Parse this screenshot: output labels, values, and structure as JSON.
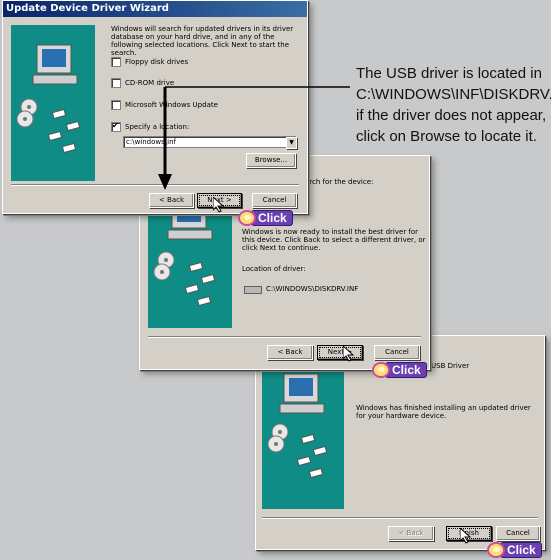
{
  "window1": {
    "title": "Update Device Driver Wizard",
    "intro": "Windows will search for updated drivers in its driver database on your hard drive, and in any of the following selected locations. Click Next to start the search.",
    "options": [
      {
        "label": "Floppy disk drives",
        "checked": false
      },
      {
        "label": "CD-ROM drive",
        "checked": false
      },
      {
        "label": "Microsoft Windows Update",
        "checked": false
      },
      {
        "label": "Specify a location:",
        "checked": true
      }
    ],
    "location_value": "c:\\windows\\inf",
    "browse_label": "Browse...",
    "back_label": "< Back",
    "next_label": "Next >",
    "cancel_label": "Cancel"
  },
  "window2": {
    "heading": "search for the device:",
    "body": "Windows is now ready to install the best driver for this device. Click Back to select a different driver, or click Next to continue.",
    "location_label": "Location of driver:",
    "location_path": "C:\\WINDOWS\\DISKDRV.INF",
    "back_label": "< Back",
    "next_label": "Next >",
    "cancel_label": "Cancel"
  },
  "window3": {
    "heading": "USB Driver",
    "body": "Windows has finished installing an updated driver for your hardware device.",
    "back_label": "< Back",
    "finish_label": "Finish",
    "cancel_label": "Cancel"
  },
  "callout": {
    "line1": "The USB driver is located in",
    "line2": "C:\\WINDOWS\\INF\\DISKDRV.inf",
    "line3": "if the driver does not appear,",
    "line4": "click on Browse to locate it."
  },
  "click_badges": [
    "Click",
    "Click",
    "Click"
  ],
  "colors": {
    "accent": "#0a246a",
    "art": "#0e8c85",
    "click_badge": "#6a3fb0",
    "background": "#c8c9cb"
  }
}
